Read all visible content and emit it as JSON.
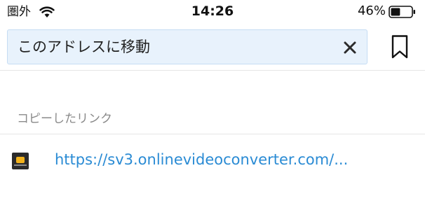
{
  "status_bar": {
    "carrier": "圏外",
    "wifi_icon": "wifi-icon",
    "time": "14:26",
    "battery_percent": "46%",
    "battery_icon": "battery-icon",
    "battery_level": 0.46
  },
  "address_bar": {
    "placeholder": "このアドレスに移動",
    "clear_icon": "close-icon"
  },
  "bookmark_icon": "bookmark-icon",
  "copied_link_section": {
    "title": "コピーしたリンク",
    "items": [
      {
        "url": "https://sv3.onlinevideoconverter.com/...",
        "favicon": "site-favicon-icon"
      }
    ]
  }
}
